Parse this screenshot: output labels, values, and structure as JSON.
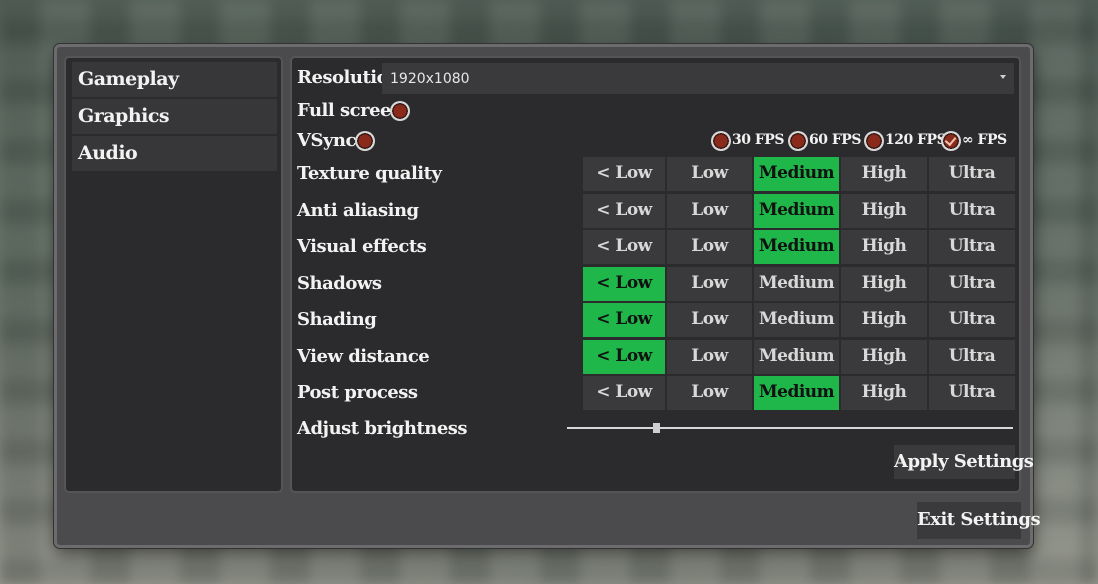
{
  "sidebar": {
    "items": [
      {
        "label": "Gameplay"
      },
      {
        "label": "Graphics"
      },
      {
        "label": "Audio"
      }
    ]
  },
  "settings": {
    "resolution_label": "Resolution",
    "resolution_value": "1920x1080",
    "fullscreen_label": "Full screen",
    "vsync_label": "VSync",
    "fps_options": [
      "30 FPS",
      "60 FPS",
      "120 FPS",
      "∞ FPS"
    ],
    "fps_selected": "∞ FPS",
    "quality_levels": [
      "< Low",
      "Low",
      "Medium",
      "High",
      "Ultra"
    ],
    "quality_rows": [
      {
        "label": "Texture quality",
        "selected": "Medium"
      },
      {
        "label": "Anti aliasing",
        "selected": "Medium"
      },
      {
        "label": "Visual effects",
        "selected": "Medium"
      },
      {
        "label": "Shadows",
        "selected": "< Low"
      },
      {
        "label": "Shading",
        "selected": "< Low"
      },
      {
        "label": "View distance",
        "selected": "< Low"
      },
      {
        "label": "Post process",
        "selected": "Medium"
      }
    ],
    "brightness_label": "Adjust brightness",
    "brightness_value": 0.2
  },
  "buttons": {
    "apply_label": "Apply Settings",
    "exit_label": "Exit Settings"
  },
  "colors": {
    "accent": "#1fb64a",
    "panel": "#2b2b2d",
    "cell": "#3a3a3c",
    "radio": "#8a2a1a"
  }
}
